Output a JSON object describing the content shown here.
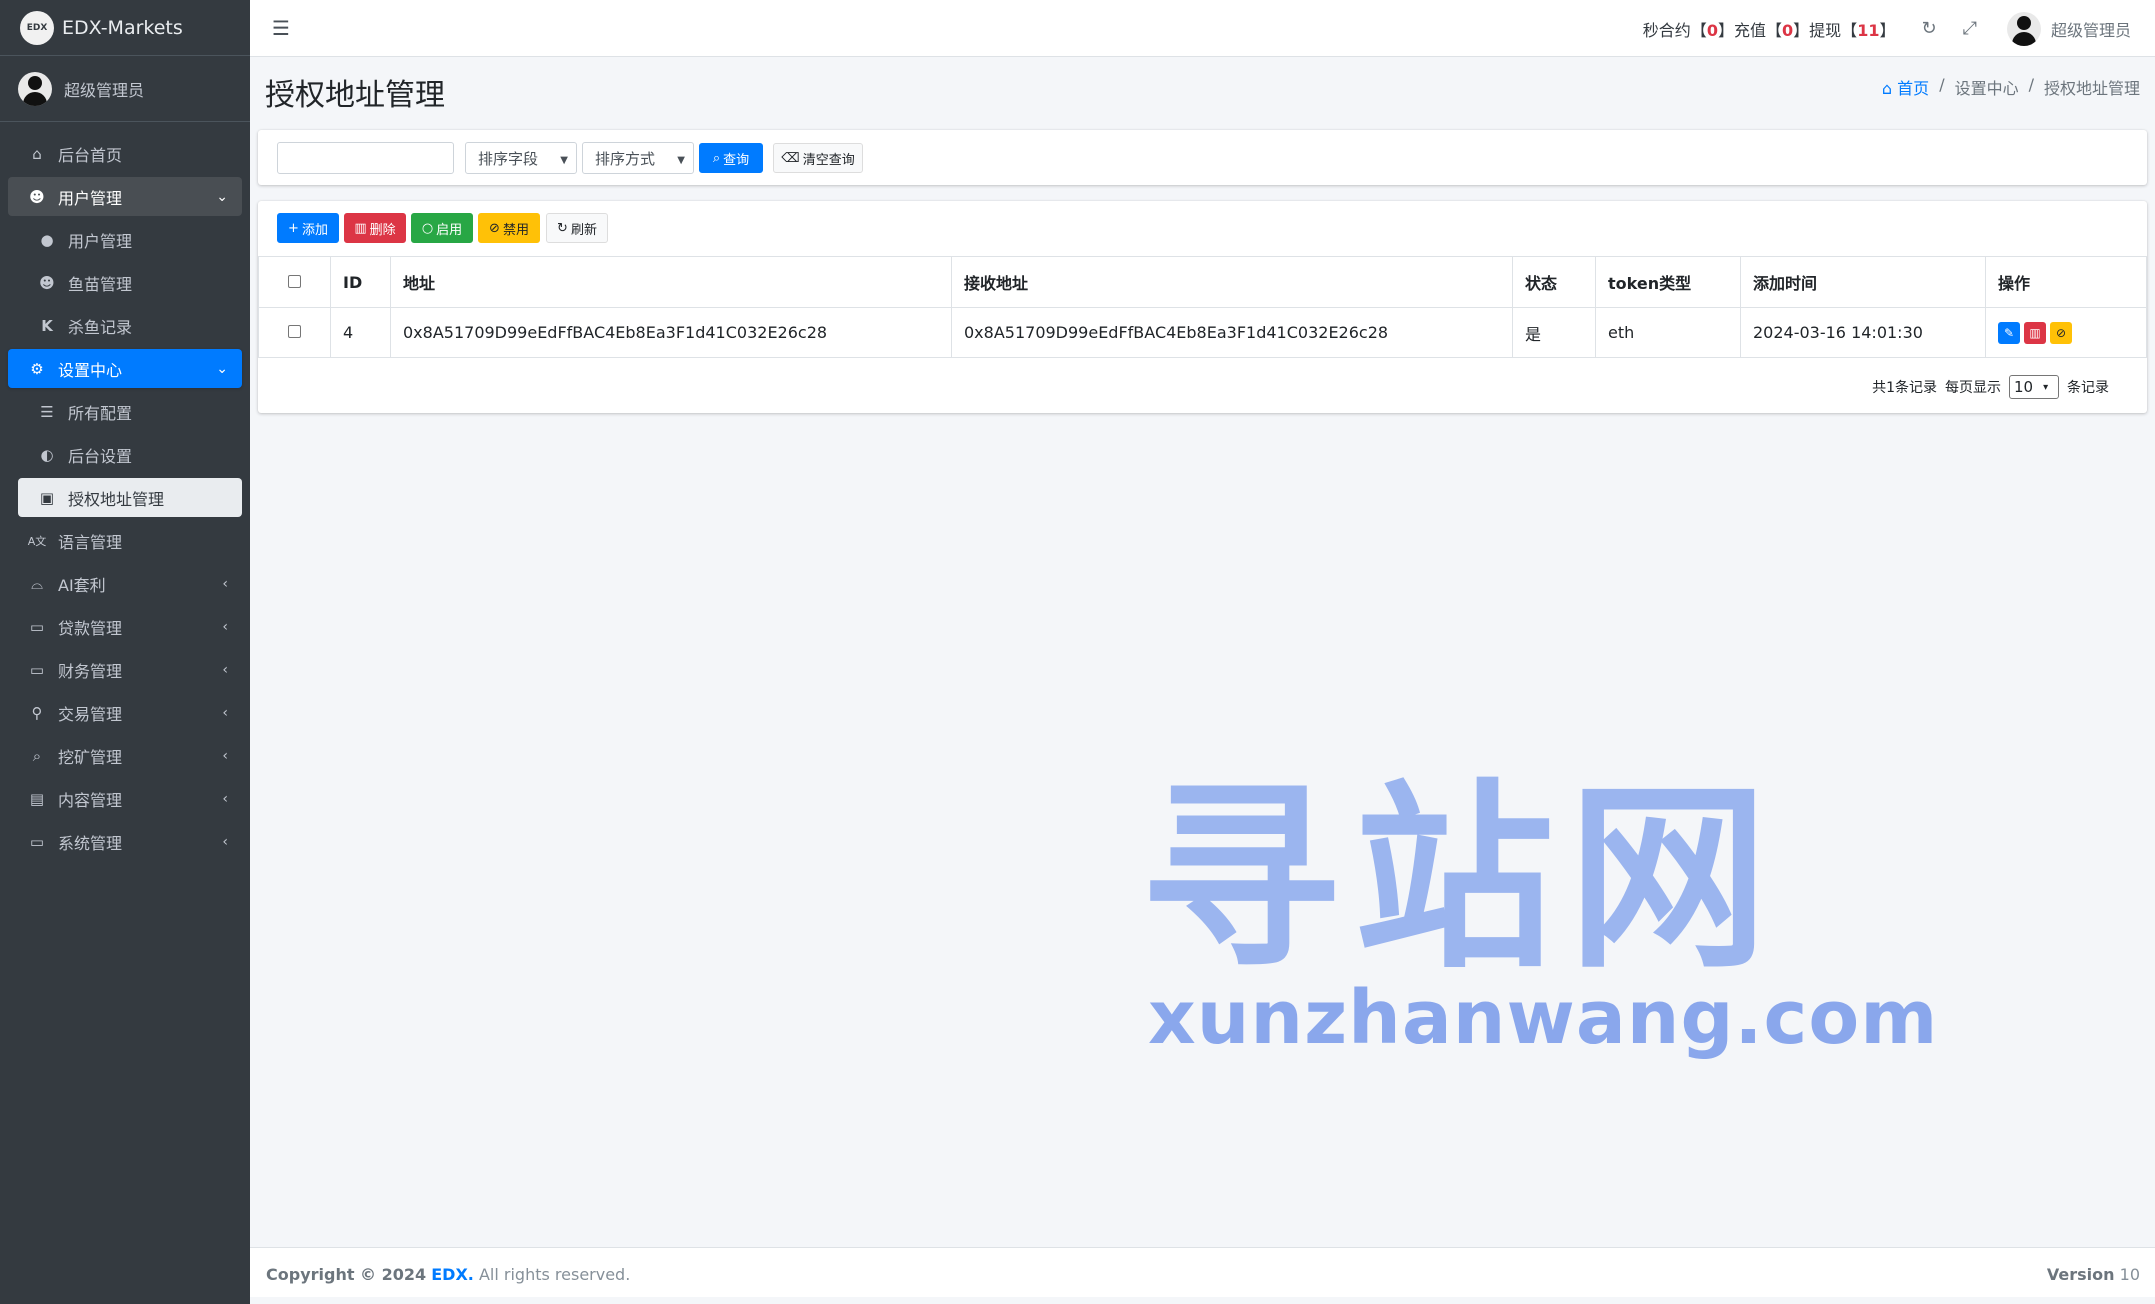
{
  "brand": {
    "logo": "EDX",
    "name": "EDX-Markets"
  },
  "user": {
    "name": "超级管理员"
  },
  "sidebar": {
    "items": [
      {
        "label": "后台首页",
        "icon": "home-icon"
      },
      {
        "label": "用户管理",
        "icon": "users-icon"
      },
      {
        "label": "用户管理",
        "icon": "user-icon"
      },
      {
        "label": "鱼苗管理",
        "icon": "users-icon"
      },
      {
        "label": "杀鱼记录",
        "icon": "k-icon"
      },
      {
        "label": "设置中心",
        "icon": "cogs-icon"
      },
      {
        "label": "所有配置",
        "icon": "list-icon"
      },
      {
        "label": "后台设置",
        "icon": "adjust-icon"
      },
      {
        "label": "授权地址管理",
        "icon": "address-book-icon"
      },
      {
        "label": "语言管理",
        "icon": "language-icon"
      },
      {
        "label": "AI套利",
        "icon": "android-icon"
      },
      {
        "label": "贷款管理",
        "icon": "money-icon"
      },
      {
        "label": "财务管理",
        "icon": "money-icon"
      },
      {
        "label": "交易管理",
        "icon": "connect-icon"
      },
      {
        "label": "挖矿管理",
        "icon": "search-icon"
      },
      {
        "label": "内容管理",
        "icon": "newspaper-icon"
      },
      {
        "label": "系统管理",
        "icon": "desktop-icon"
      }
    ]
  },
  "topbar": {
    "stat1_label": "秒合约",
    "stat1_value": "0",
    "stat2_label": "充值",
    "stat2_value": "0",
    "stat3_label": "提现",
    "stat3_value": "11",
    "user_name": "超级管理员"
  },
  "page": {
    "title": "授权地址管理"
  },
  "breadcrumb": {
    "home": "首页",
    "level1": "设置中心",
    "current": "授权地址管理"
  },
  "search": {
    "input_value": "",
    "sort_field": "排序字段",
    "sort_order": "排序方式",
    "query_label": "查询",
    "clear_label": "清空查询"
  },
  "toolbar": {
    "add": "添加",
    "delete": "删除",
    "enable": "启用",
    "disable": "禁用",
    "refresh": "刷新"
  },
  "table": {
    "headers": [
      "ID",
      "地址",
      "接收地址",
      "状态",
      "token类型",
      "添加时间",
      "操作"
    ],
    "rows": [
      {
        "id": "4",
        "address": "0x8A51709D99eEdFfBAC4Eb8Ea3F1d41C032E26c28",
        "receive": "0x8A51709D99eEdFfBAC4Eb8Ea3F1d41C032E26c28",
        "status": "是",
        "token": "eth",
        "time": "2024-03-16 14:01:30"
      }
    ]
  },
  "pager": {
    "total": "共1条记录",
    "per_page_label": "每页显示",
    "per_page_value": "10",
    "suffix": "条记录"
  },
  "watermark": {
    "cn": "寻站网",
    "en": "xunzhanwang.com"
  },
  "footer": {
    "copyright": "Copyright © 2024",
    "brand": "EDX.",
    "rights": "All rights reserved.",
    "version_label": "Version",
    "version_value": "10"
  },
  "colors": {
    "primary": "#007bff",
    "danger": "#dc3545",
    "success": "#28a745",
    "warning": "#ffc107",
    "sidebar": "#343a40"
  }
}
